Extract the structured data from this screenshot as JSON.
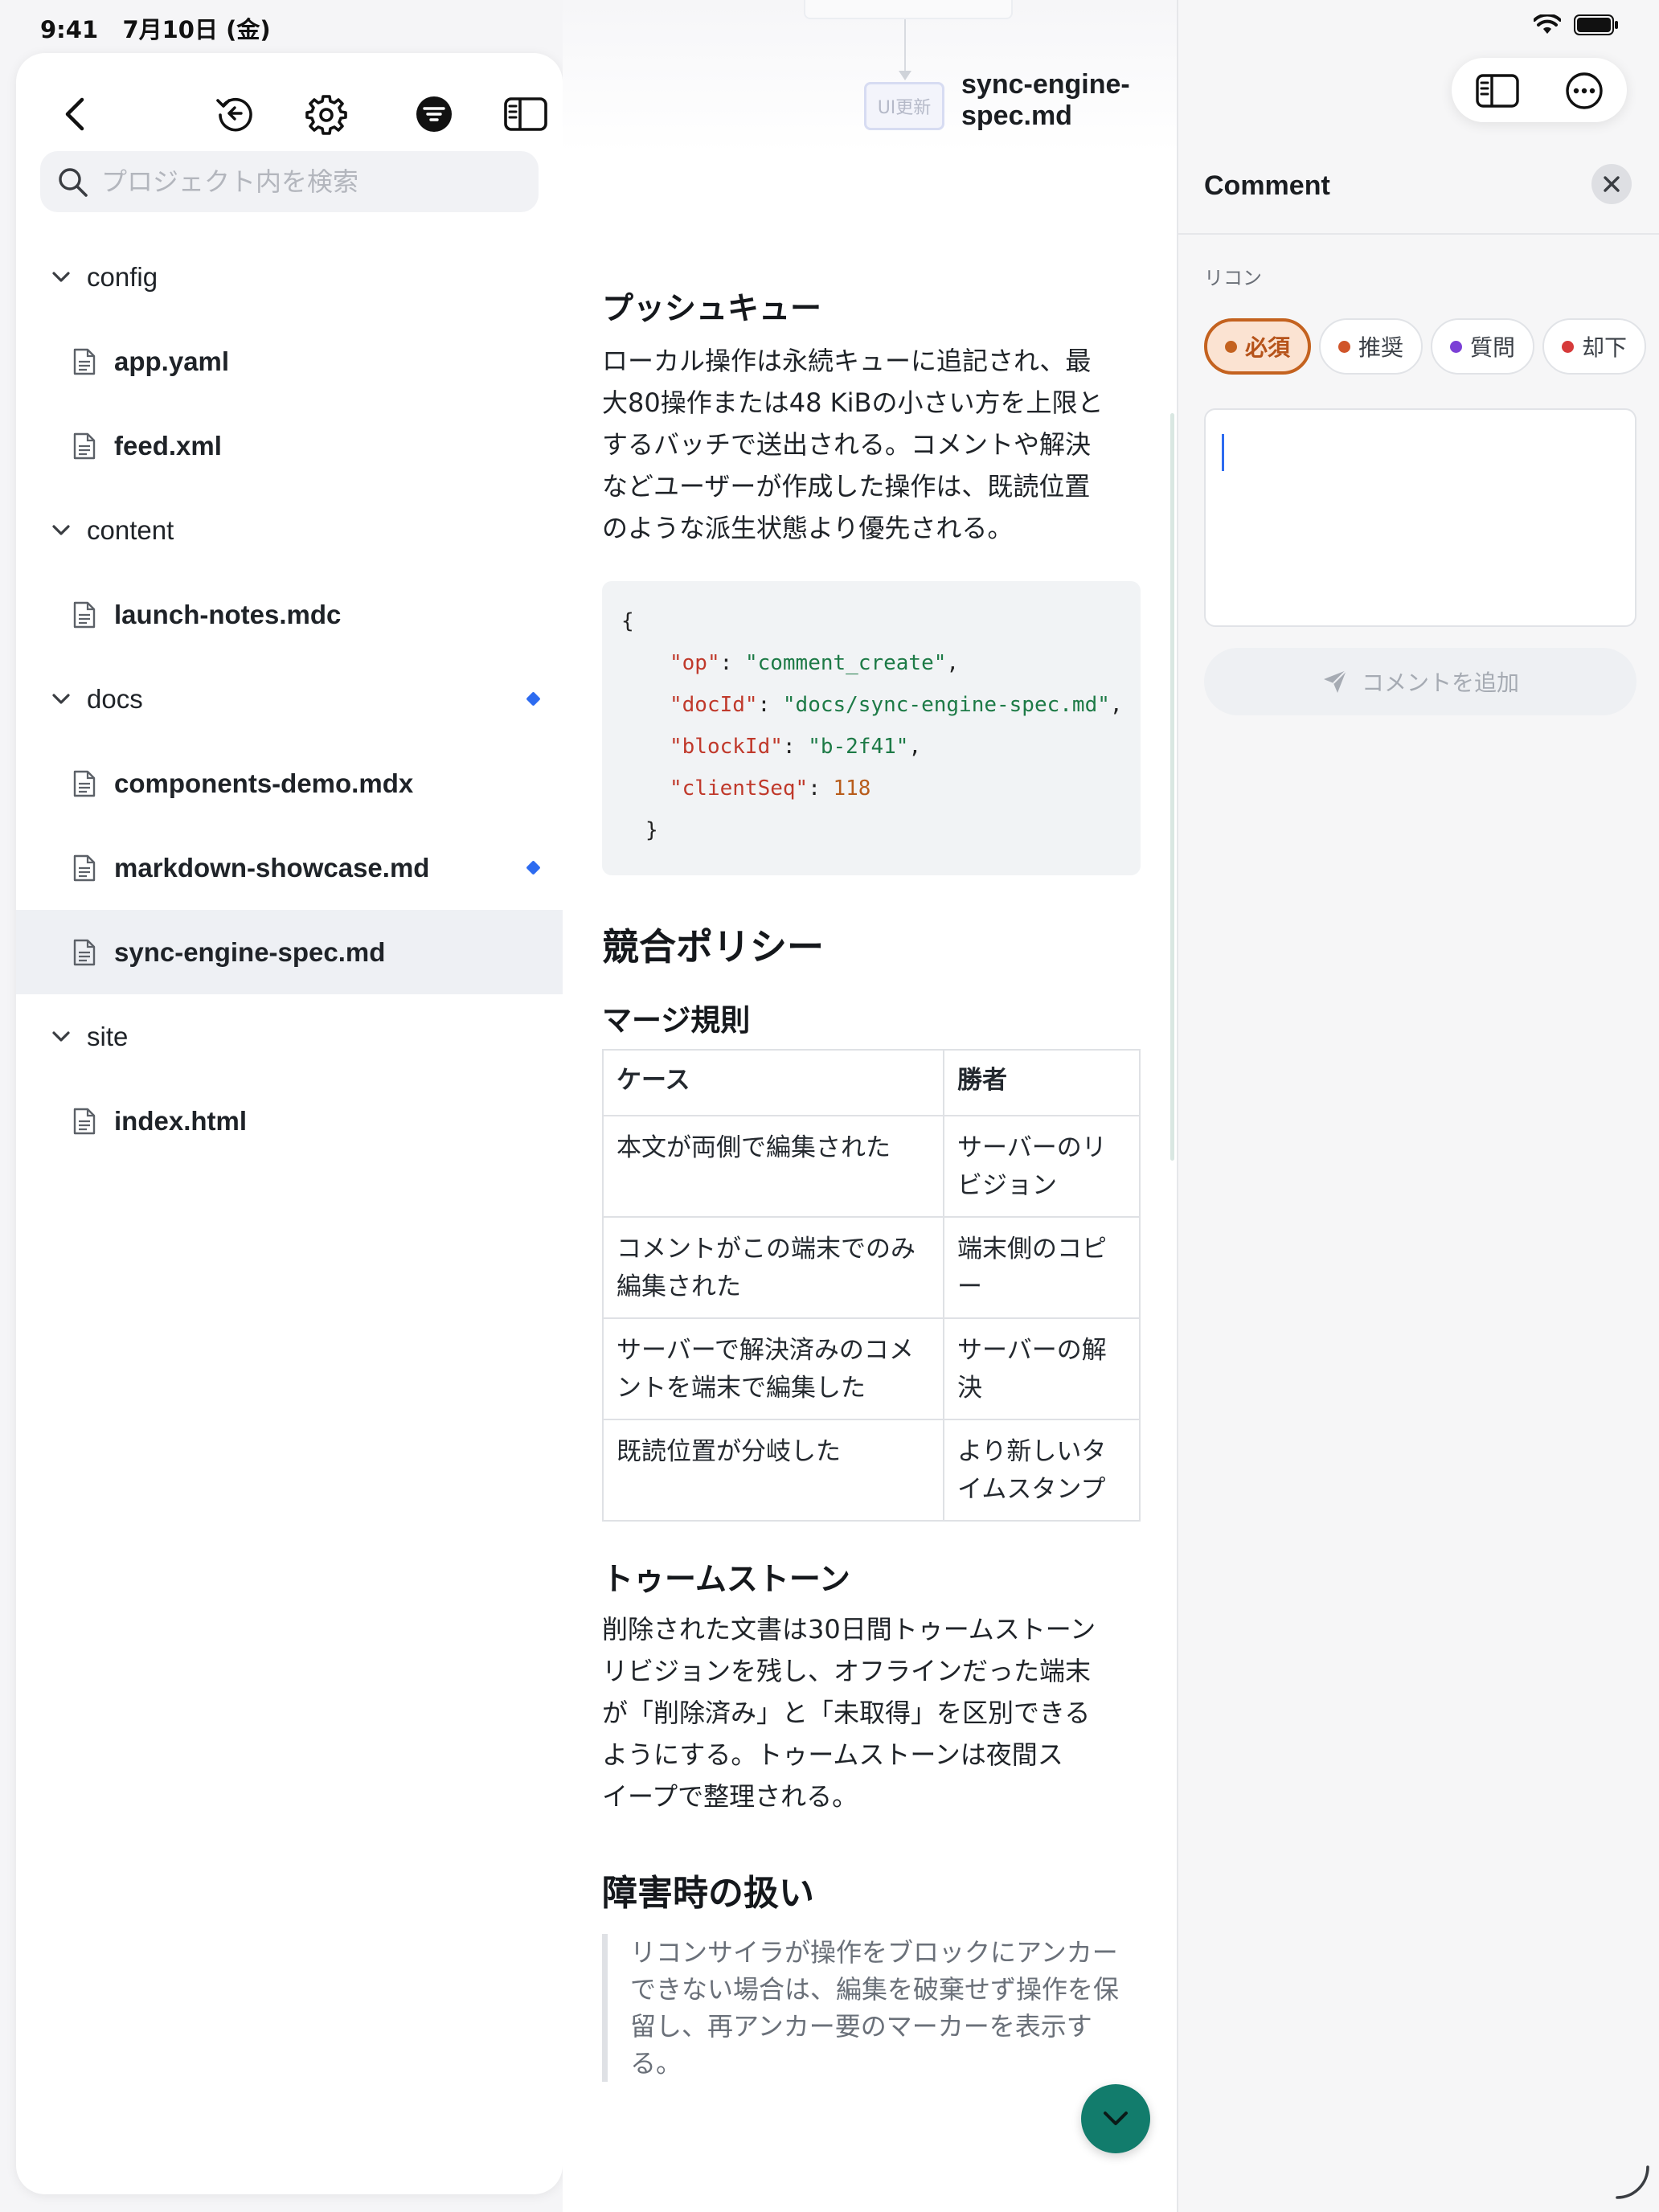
{
  "status": {
    "time": "9:41",
    "date": "7月10日 (金)"
  },
  "sidebar": {
    "search_placeholder": "プロジェクト内を検索",
    "tree": [
      {
        "type": "folder",
        "label": "config"
      },
      {
        "type": "file",
        "label": "app.yaml"
      },
      {
        "type": "file",
        "label": "feed.xml"
      },
      {
        "type": "folder",
        "label": "content"
      },
      {
        "type": "file",
        "label": "launch-notes.mdc"
      },
      {
        "type": "folder",
        "label": "docs",
        "modified": true
      },
      {
        "type": "file",
        "label": "components-demo.mdx"
      },
      {
        "type": "file",
        "label": "markdown-showcase.md",
        "modified": true
      },
      {
        "type": "file",
        "label": "sync-engine-spec.md",
        "selected": true
      },
      {
        "type": "folder",
        "label": "site"
      },
      {
        "type": "file",
        "label": "index.html"
      }
    ]
  },
  "document": {
    "title": "sync-engine-spec.md",
    "diagram_node": "UI更新",
    "push_queue": {
      "heading": "プッシュキュー",
      "lines": [
        "ローカル操作は永続キューに追記され、最",
        "大80操作または48 KiBの小さい方を上限と",
        "するバッチで送出される。コメントや解決",
        "などユーザーが作成した操作は、既読位置",
        "のような派生状態より優先される。"
      ]
    },
    "code": {
      "open": "{",
      "close": "}",
      "entries": [
        {
          "key": "\"op\"",
          "value": "\"comment_create\"",
          "kind": "string"
        },
        {
          "key": "\"docId\"",
          "value": "\"docs/sync-engine-spec.md\"",
          "kind": "string"
        },
        {
          "key": "\"blockId\"",
          "value": "\"b-2f41\"",
          "kind": "string"
        },
        {
          "key": "\"clientSeq\"",
          "value": "118",
          "kind": "number"
        }
      ]
    },
    "conflict": {
      "heading": "競合ポリシー",
      "merge_heading": "マージ規則",
      "table_headers": [
        "ケース",
        "勝者"
      ],
      "table_rows": [
        [
          "本文が両側で編集された",
          "サーバーのリビジョン"
        ],
        [
          "コメントがこの端末でのみ編集された",
          "端末側のコピー"
        ],
        [
          "サーバーで解決済みのコメントを端末で編集した",
          "サーバーの解決"
        ],
        [
          "既読位置が分岐した",
          "より新しいタイムスタンプ"
        ]
      ]
    },
    "tombstone": {
      "heading": "トゥームストーン",
      "lines": [
        "削除された文書は30日間トゥームストーン",
        "リビジョンを残し、オフラインだった端末",
        "が「削除済み」と「未取得」を区別できる",
        "ようにする。トゥームストーンは夜間ス",
        "イープで整理される。"
      ]
    },
    "failure": {
      "heading": "障害時の扱い",
      "quote_lines": [
        "リコンサイラが操作をブロックにアンカー",
        "できない場合は、編集を破棄せず操作を保",
        "留し、再アンカー要のマーカーを表示す",
        "る。"
      ]
    }
  },
  "panel": {
    "title": "Comment",
    "field_label": "リコン",
    "chips": [
      {
        "label": "必須",
        "color": "#c4621f",
        "active": true
      },
      {
        "label": "推奨",
        "color": "#d0552a",
        "active": false
      },
      {
        "label": "質問",
        "color": "#7b3fd6",
        "active": false
      },
      {
        "label": "却下",
        "color": "#d63a3a",
        "active": false
      }
    ],
    "comment_value": "",
    "submit_label": "コメントを追加"
  },
  "colors": {
    "accent": "#127c6c",
    "selection": "#eef0f4",
    "modified": "#2d6bf0"
  }
}
